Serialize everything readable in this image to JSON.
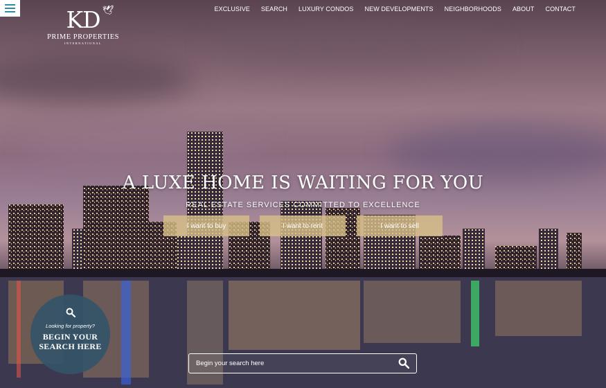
{
  "brand": {
    "logo_mark": "KD",
    "name": "PRIME PROPERTIES",
    "subtitle": "INTERNATIONAL"
  },
  "nav": {
    "items": [
      "EXCLUSIVE",
      "SEARCH",
      "LUXURY CONDOS",
      "NEW DEVELOPMENTS",
      "NEIGHBORHOODS",
      "ABOUT",
      "CONTACT"
    ]
  },
  "hero": {
    "headline": "A LUXE HOME IS WAITING FOR YOU",
    "tagline": "REAL ESTATE SERVICES COMMITTED TO EXCELLENCE",
    "buttons": [
      "I want to buy",
      "I want to rent",
      "I want to sell"
    ]
  },
  "search_circle": {
    "question": "Looking for property?",
    "line1": "BEGIN YOUR",
    "line2": "SEARCH HERE"
  },
  "search": {
    "placeholder": "Begin your search here"
  },
  "icons": {
    "menu": "hamburger-menu-icon",
    "search": "search-icon",
    "bird": "bird-icon"
  },
  "colors": {
    "accent": "#2f8aa6",
    "cta": "#d7be87",
    "circle": "#345468"
  }
}
